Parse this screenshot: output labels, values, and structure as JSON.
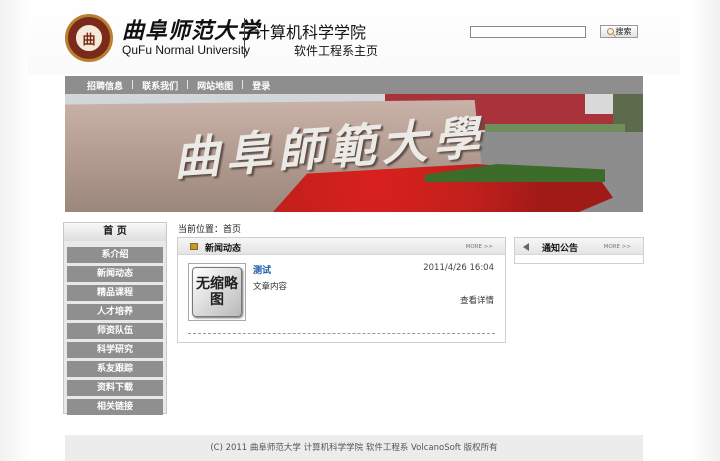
{
  "header": {
    "logo_seal_text": "曲",
    "school_cn": "曲阜师范大学",
    "school_en": "QuFu Normal University",
    "college": "计算机科学学院",
    "department": "软件工程系主页",
    "search_placeholder": "",
    "search_button": "搜索"
  },
  "nav": {
    "items": [
      "招聘信息",
      "联系我们",
      "网站地图",
      "登录"
    ],
    "separator": "|"
  },
  "banner": {
    "stone_text": "曲阜師範大學"
  },
  "sidebar": {
    "home": "首 页",
    "items": [
      "系介绍",
      "新闻动态",
      "精品课程",
      "人才培养",
      "师资队伍",
      "科学研究",
      "系友跟踪",
      "资料下载",
      "相关链接"
    ]
  },
  "breadcrumb": "当前位置：首页",
  "news": {
    "title": "新闻动态",
    "more": "MORE >>",
    "thumb_text": "无缩略图",
    "item": {
      "title": "测试",
      "date": "2011/4/26 16:04",
      "content": "文章内容",
      "detail": "查看详情"
    }
  },
  "notice": {
    "title": "通知公告",
    "more": "MORE >>"
  },
  "footer": "(C) 2011 曲阜师范大学  计算机科学学院  软件工程系  VolcanoSoft 版权所有",
  "colors": {
    "nav_bg": "#8e8e8e",
    "sidebar_item_bg": "#8f8f8f",
    "link_blue": "#1a5aa6",
    "seal_red": "#7a2a1a"
  }
}
